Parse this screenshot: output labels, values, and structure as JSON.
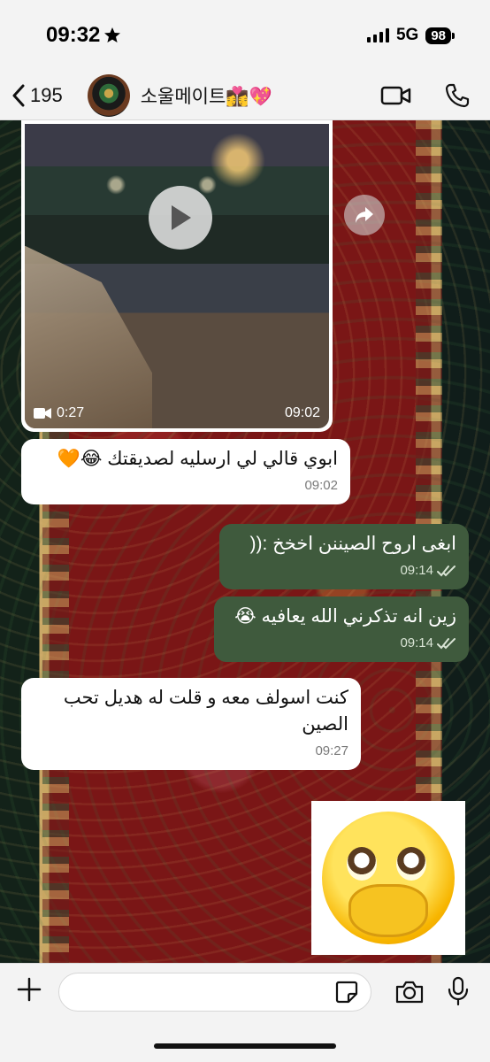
{
  "status_bar": {
    "time": "09:32",
    "network": "5G",
    "battery": "98"
  },
  "header": {
    "back_count": "195",
    "contact_name": "소울메이트👩‍❤️‍💋‍👩💖"
  },
  "video_message": {
    "duration": "0:27",
    "time": "09:02"
  },
  "messages": [
    {
      "direction": "in",
      "text": "ابوي قالي لي ارسليه لصديقتك 😂🧡",
      "time": "09:02"
    },
    {
      "direction": "out",
      "text": "ابغى اروح الصيننن اخخخ :((",
      "time": "09:14"
    },
    {
      "direction": "out",
      "text": "زين انه تذكرني الله يعافيه 😭",
      "time": "09:14"
    },
    {
      "direction": "in",
      "text": "كنت اسولف معه و قلت له هديل تحب الصين",
      "time": "09:27"
    }
  ],
  "input": {
    "value": ""
  },
  "icons": {
    "back": "chevron-left-icon",
    "video_call": "video-camera-icon",
    "phone": "phone-icon",
    "play": "play-icon",
    "forward": "forward-icon",
    "plus": "plus-icon",
    "sticker": "sticker-icon",
    "camera": "camera-icon",
    "mic": "microphone-icon",
    "read": "double-check-icon"
  },
  "colors": {
    "outgoing_bubble": "#3f5a3d",
    "incoming_bubble": "#ffffff",
    "bar_background": "#f3f3f3"
  }
}
